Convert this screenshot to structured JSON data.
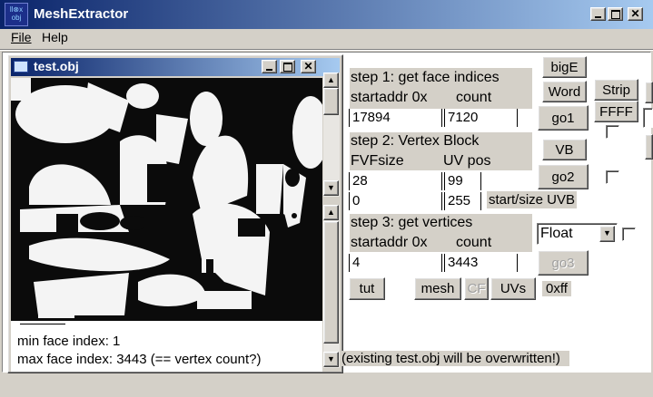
{
  "window": {
    "title": "MeshExtractor",
    "app_icon_text": "ll⊗x obj"
  },
  "menu": {
    "file": "File",
    "help": "Help"
  },
  "child": {
    "title": "test.obj",
    "log_lines": [
      "min face index: 1",
      "max face index: 3443 (== vertex count?)"
    ]
  },
  "step1": {
    "title": "step 1: get face indices",
    "startaddr_label": "startaddr 0x",
    "count_label": "count",
    "startaddr_value": "17894",
    "count_value": "7120"
  },
  "step2": {
    "title": "step 2: Vertex Block",
    "fvf_label": "FVFsize",
    "uvpos_label": "UV pos",
    "fvf_value": "28",
    "uvpos_value": "99",
    "start_value": "0",
    "size_value": "255",
    "start_size_label": "start/size UVB"
  },
  "step3": {
    "title": "step 3: get vertices",
    "startaddr_label": "startaddr 0x",
    "count_label": "count",
    "startaddr_value": "4",
    "count_value": "3443",
    "type_selected": "Float"
  },
  "buttons": {
    "bigE": "bigE",
    "word": "Word",
    "strip": "Strip",
    "ffff": "FFFF",
    "go1": "go1",
    "vb": "VB",
    "go2": "go2",
    "go3": "go3",
    "tut": "tut",
    "mesh": "mesh",
    "cf": "CF",
    "uvs": "UVs"
  },
  "hex_label": "0xff",
  "status_text": "(existing test.obj will be overwritten!)",
  "colors": {
    "titlebar_start": "#0a246a",
    "titlebar_end": "#a6caf0",
    "inactive_title": "#6b8fc9"
  }
}
